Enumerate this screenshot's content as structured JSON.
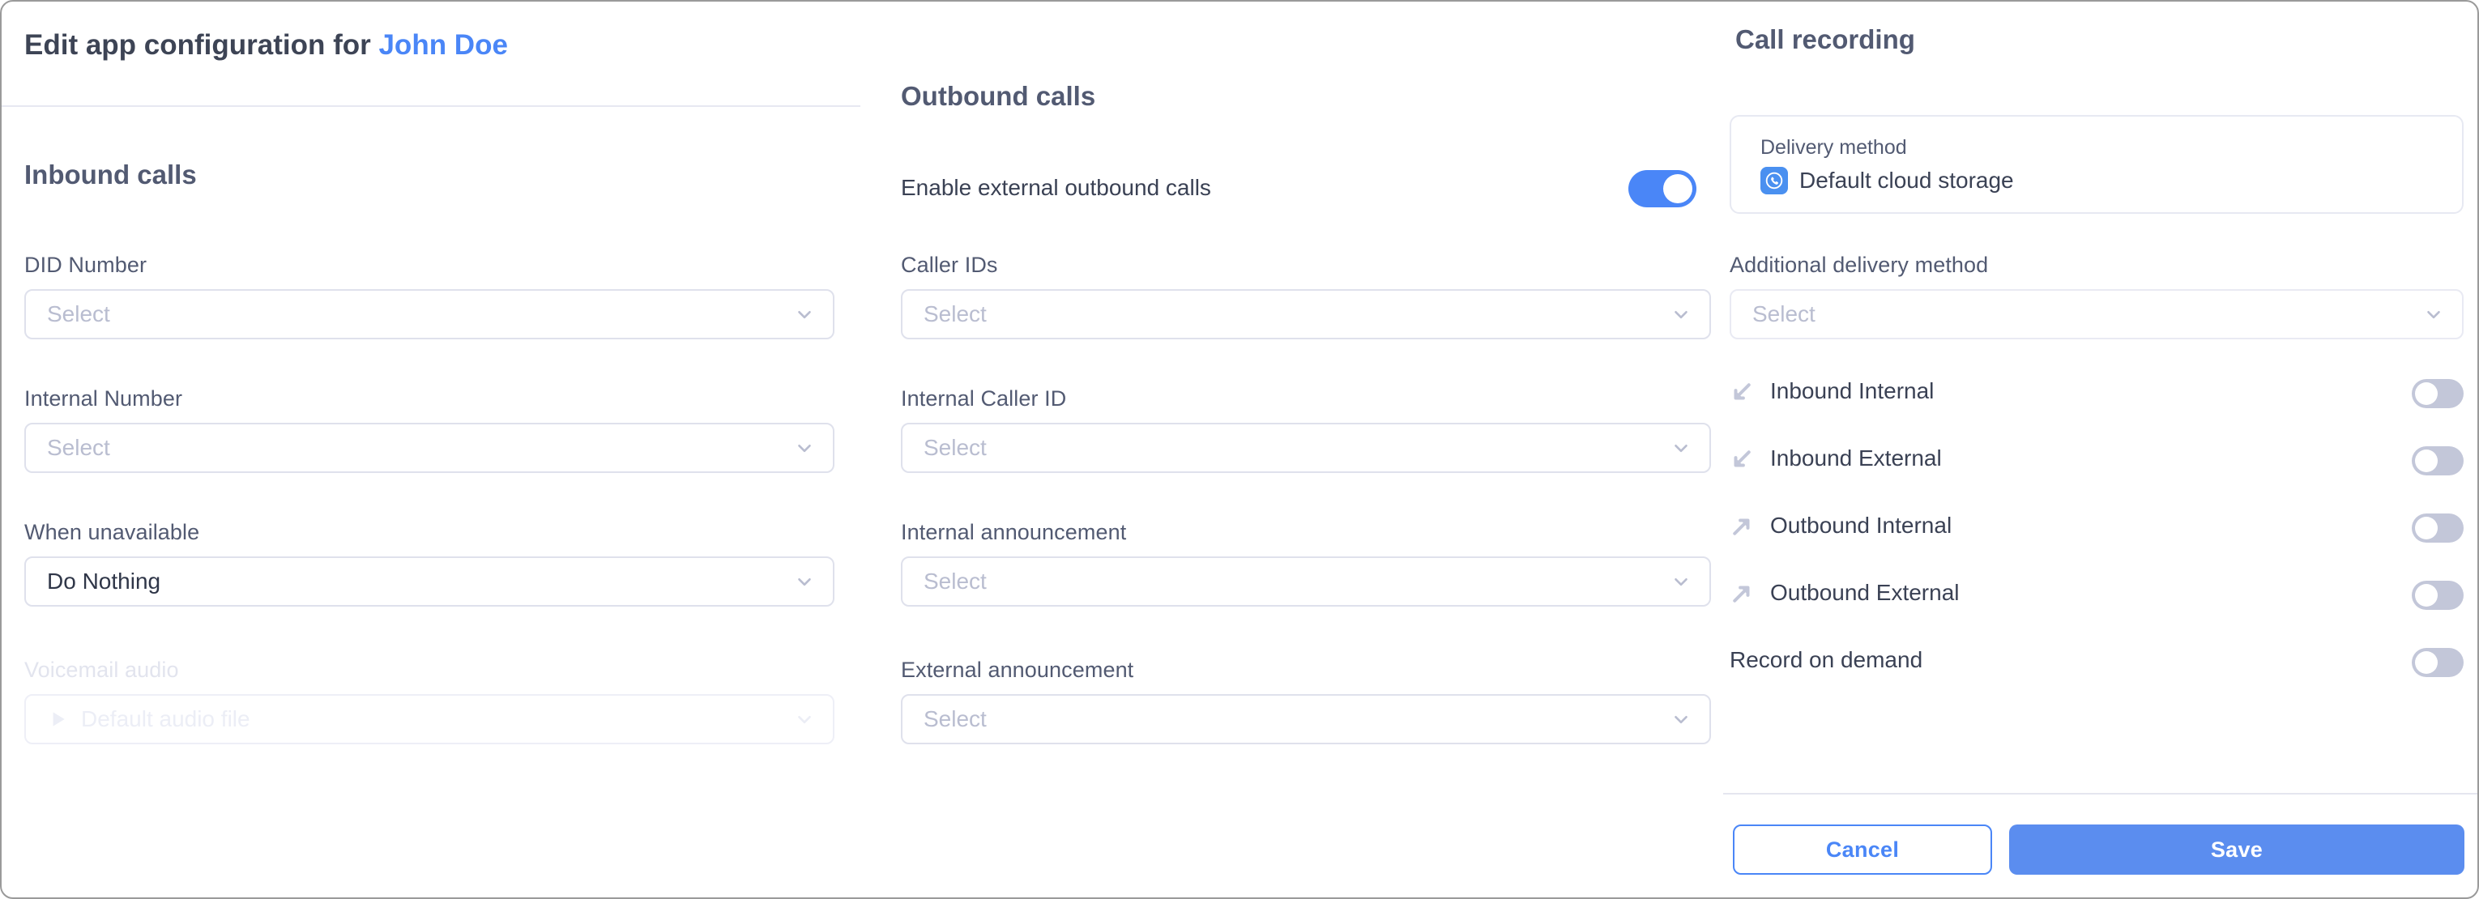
{
  "header": {
    "title_prefix": "Edit app configuration for ",
    "user_name": "John Doe",
    "accent_color": "#4a86f7"
  },
  "inbound": {
    "heading": "Inbound calls",
    "fields": [
      {
        "label": "DID Number",
        "value": "Select",
        "is_placeholder": true,
        "disabled": false
      },
      {
        "label": "Internal Number",
        "value": "Select",
        "is_placeholder": true,
        "disabled": false
      },
      {
        "label": "When unavailable",
        "value": "Do Nothing",
        "is_placeholder": false,
        "disabled": false
      },
      {
        "label": "Voicemail audio",
        "value": "Default audio file",
        "is_placeholder": true,
        "disabled": true,
        "icon": "play-icon"
      }
    ]
  },
  "outbound": {
    "heading": "Outbound calls",
    "enable_label": "Enable external outbound calls",
    "enable_state": "on",
    "fields": [
      {
        "label": "Caller IDs",
        "value": "Select",
        "is_placeholder": true
      },
      {
        "label": "Internal Caller ID",
        "value": "Select",
        "is_placeholder": true
      },
      {
        "label": "Internal announcement",
        "value": "Select",
        "is_placeholder": true
      },
      {
        "label": "External announcement",
        "value": "Select",
        "is_placeholder": true
      }
    ]
  },
  "recording": {
    "heading": "Call recording",
    "delivery_method_label": "Delivery method",
    "delivery_method_value": "Default cloud storage",
    "delivery_method_icon": "cloud-phone-icon",
    "additional_label": "Additional delivery method",
    "additional_value": "Select",
    "rows": [
      {
        "label": "Inbound Internal",
        "icon": "call-inbound-icon",
        "state": "off"
      },
      {
        "label": "Inbound External",
        "icon": "call-inbound-icon",
        "state": "off"
      },
      {
        "label": "Outbound Internal",
        "icon": "call-outbound-icon",
        "state": "off"
      },
      {
        "label": "Outbound External",
        "icon": "call-outbound-icon",
        "state": "off"
      },
      {
        "label": "Record on demand",
        "icon": null,
        "state": "off"
      }
    ]
  },
  "footer": {
    "cancel_label": "Cancel",
    "save_label": "Save"
  }
}
